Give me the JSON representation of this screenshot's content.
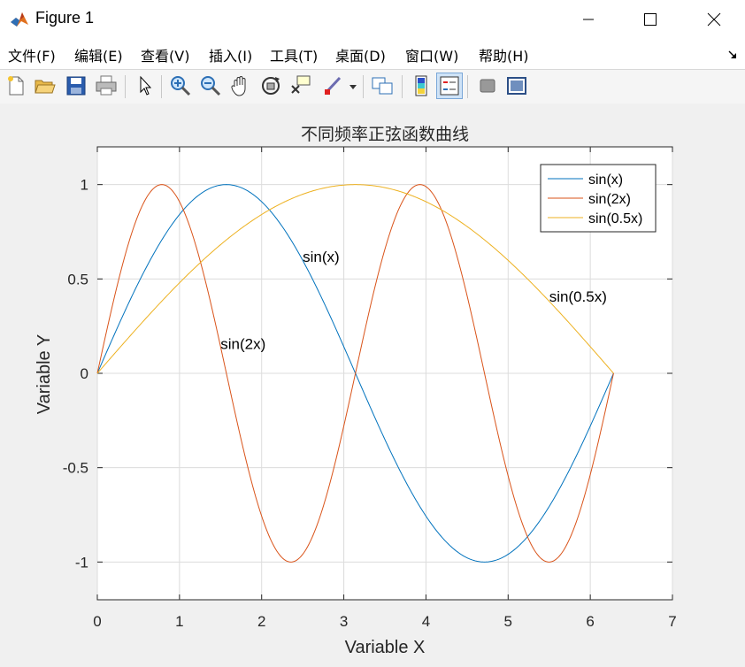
{
  "window": {
    "title": "Figure 1"
  },
  "menu": [
    "文件(F)",
    "编辑(E)",
    "查看(V)",
    "插入(I)",
    "工具(T)",
    "桌面(D)",
    "窗口(W)",
    "帮助(H)"
  ],
  "toolbar": [
    "new-figure-icon",
    "open-file-icon",
    "save-icon",
    "print-icon",
    "pointer-icon",
    "zoom-in-icon",
    "zoom-out-icon",
    "pan-icon",
    "rotate-3d-icon",
    "data-cursor-icon",
    "brush-icon",
    "link-plot-icon",
    "colorbar-icon",
    "legend-icon",
    "hide-plot-tools-icon",
    "show-plot-tools-icon"
  ],
  "chart_data": {
    "type": "line",
    "title": "不同频率正弦函数曲线",
    "xlabel": "Variable X",
    "ylabel": "Variable Y",
    "xlim": [
      0,
      7
    ],
    "ylim": [
      -1.2,
      1.2
    ],
    "xticks": [
      0,
      1,
      2,
      3,
      4,
      5,
      6,
      7
    ],
    "yticks": [
      -1,
      -0.5,
      0,
      0.5,
      1
    ],
    "grid": true,
    "legend_location": "top-right",
    "x_range": [
      0,
      6.2832
    ],
    "series": [
      {
        "name": "sin(x)",
        "function": "sin(x)",
        "color": "#0072BD"
      },
      {
        "name": "sin(2x)",
        "function": "sin(2x)",
        "color": "#D95319"
      },
      {
        "name": "sin(0.5x)",
        "function": "sin(0.5x)",
        "color": "#EDB120"
      }
    ],
    "annotations": [
      {
        "text": "sin(x)",
        "x": 2.5,
        "y": 0.59
      },
      {
        "text": "sin(2x)",
        "x": 1.5,
        "y": 0.13
      },
      {
        "text": "sin(0.5x)",
        "x": 5.5,
        "y": 0.38
      }
    ]
  }
}
